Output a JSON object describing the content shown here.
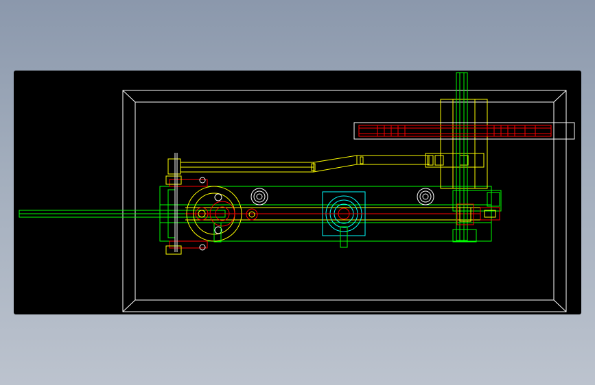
{
  "view": {
    "background": "#000000",
    "canvas_color": "#000000"
  },
  "layers": {
    "frame": "#ffffff",
    "structure": "#00ff00",
    "linkage": "#ffff00",
    "hardware": "#ff0000",
    "fixture": "#00ffff",
    "detail": "#ffffff"
  },
  "icons": {
    "pivot": "circle-bolt-icon",
    "bearing": "bearing-icon",
    "clamp": "clamp-block-icon"
  }
}
